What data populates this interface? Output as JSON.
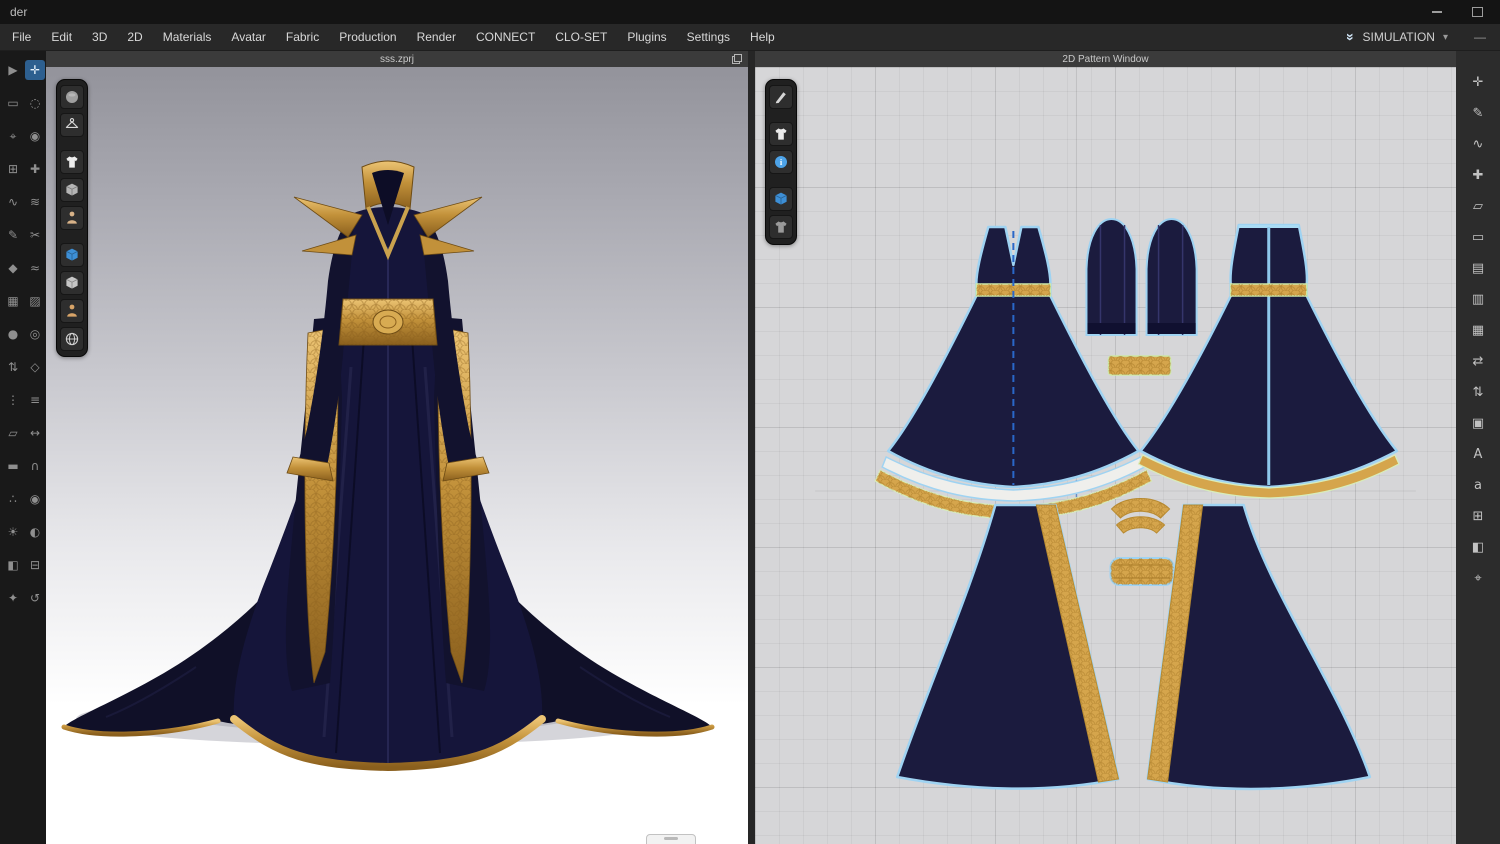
{
  "titlebar": {
    "title": "der"
  },
  "menubar": {
    "items": [
      {
        "label": "File",
        "name": "menu-file"
      },
      {
        "label": "Edit",
        "name": "menu-edit"
      },
      {
        "label": "3D",
        "name": "menu-3d"
      },
      {
        "label": "2D",
        "name": "menu-2d"
      },
      {
        "label": "Materials",
        "name": "menu-materials"
      },
      {
        "label": "Avatar",
        "name": "menu-avatar"
      },
      {
        "label": "Fabric",
        "name": "menu-fabric"
      },
      {
        "label": "Production",
        "name": "menu-production"
      },
      {
        "label": "Render",
        "name": "menu-render"
      },
      {
        "label": "CONNECT",
        "name": "menu-connect"
      },
      {
        "label": "CLO-SET",
        "name": "menu-clo-set"
      },
      {
        "label": "Plugins",
        "name": "menu-plugins"
      },
      {
        "label": "Settings",
        "name": "menu-settings"
      },
      {
        "label": "Help",
        "name": "menu-help"
      }
    ],
    "simulation": {
      "label": "SIMULATION"
    }
  },
  "panel_3d": {
    "title": "sss.zprj"
  },
  "panel_2d": {
    "title": "2D Pattern Window"
  },
  "static_icons": [
    "minimize-icon",
    "maximize-icon",
    "undock-icon",
    "simulation-chevron-icon",
    "simulation-caret-icon",
    "menubar-minimize-icon"
  ],
  "toolbars": {
    "left_3d": [
      {
        "name": "simulate-icon",
        "glyph": "▶"
      },
      {
        "name": "select-move-icon",
        "glyph": "✛",
        "sel": "1"
      },
      {
        "name": "select-box-icon",
        "glyph": "▭"
      },
      {
        "name": "select-lasso-icon",
        "glyph": "◌"
      },
      {
        "name": "transform-gizmo-icon",
        "glyph": "⌖"
      },
      {
        "name": "pin-icon",
        "glyph": "◉"
      },
      {
        "name": "pin-box-icon",
        "glyph": "⊞"
      },
      {
        "name": "tack-icon",
        "glyph": "✚"
      },
      {
        "name": "segment-sewing-icon",
        "glyph": "∿"
      },
      {
        "name": "free-sewing-icon",
        "glyph": "≋"
      },
      {
        "name": "edit-sewing-icon",
        "glyph": "✎"
      },
      {
        "name": "remove-sewing-icon",
        "glyph": "✂"
      },
      {
        "name": "fold-arrangement-icon",
        "glyph": "◆"
      },
      {
        "name": "wind-icon",
        "glyph": "≈"
      },
      {
        "name": "fabric-swatch-icon",
        "glyph": "▦"
      },
      {
        "name": "texture-icon",
        "glyph": "▨"
      },
      {
        "name": "button-icon",
        "glyph": "●"
      },
      {
        "name": "buttonhole-icon",
        "glyph": "◎"
      },
      {
        "name": "zipper-icon",
        "glyph": "⇅"
      },
      {
        "name": "trim-icon",
        "glyph": "◇"
      },
      {
        "name": "topstitch-icon",
        "glyph": "⋮"
      },
      {
        "name": "shirring-icon",
        "glyph": "≡"
      },
      {
        "name": "flatten-icon",
        "glyph": "▱"
      },
      {
        "name": "measure-icon",
        "glyph": "↔"
      },
      {
        "name": "tape-icon",
        "glyph": "▬"
      },
      {
        "name": "avatar-tape-icon",
        "glyph": "∩"
      },
      {
        "name": "arrangement-point-icon",
        "glyph": "∴"
      },
      {
        "name": "camera-icon",
        "glyph": "◉"
      },
      {
        "name": "light-icon",
        "glyph": "☀"
      },
      {
        "name": "render-preview-icon",
        "glyph": "◐"
      },
      {
        "name": "colorway-icon",
        "glyph": "◧"
      },
      {
        "name": "uv-edit-icon",
        "glyph": "⊟"
      },
      {
        "name": "avatar-display-icon",
        "glyph": "✦"
      },
      {
        "name": "history-icon",
        "glyph": "↺"
      }
    ],
    "right_2d": [
      {
        "name": "transform-pattern-icon",
        "glyph": "✛"
      },
      {
        "name": "edit-pattern-icon",
        "glyph": "✎"
      },
      {
        "name": "edit-curvature-icon",
        "glyph": "∿"
      },
      {
        "name": "add-point-icon",
        "glyph": "✚"
      },
      {
        "name": "create-polygon-icon",
        "glyph": "▱"
      },
      {
        "name": "create-rectangle-icon",
        "glyph": "▭"
      },
      {
        "name": "copy-pattern-icon",
        "glyph": "▤"
      },
      {
        "name": "mirror-paste-icon",
        "glyph": "▥"
      },
      {
        "name": "clone-layer-icon",
        "glyph": "▦"
      },
      {
        "name": "unfold-icon",
        "glyph": "⇄"
      },
      {
        "name": "fold-icon",
        "glyph": "⇅"
      },
      {
        "name": "seam-allowance-icon",
        "glyph": "▣"
      },
      {
        "name": "text-tool-icon",
        "glyph": "A"
      },
      {
        "name": "annotation-tool-icon",
        "glyph": "a"
      },
      {
        "name": "grading-icon",
        "glyph": "⊞"
      },
      {
        "name": "texture-edit-icon",
        "glyph": "◧"
      },
      {
        "name": "zoom-fit-icon",
        "glyph": "⌖"
      }
    ],
    "float_3d": [
      {
        "name": "render-style-icon",
        "symbol": "#sym-sphere",
        "style": "color:#9f9f9f"
      },
      {
        "name": "hanger-icon",
        "symbol": "#sym-hanger",
        "style": "color:#d6d6d6"
      },
      {
        "name": "show-garment-icon",
        "symbol": "#sym-shirt",
        "style": "color:#ececec",
        "grp": "1"
      },
      {
        "name": "show-attachments-icon",
        "symbol": "#sym-cube",
        "style": "color:#b5b5b5"
      },
      {
        "name": "show-avatar-icon",
        "symbol": "#sym-person",
        "style": "color:#d8b288"
      },
      {
        "name": "gizmo-toggle-icon",
        "symbol": "#sym-cube",
        "style": "color:#3d8fd6",
        "grp": "1"
      },
      {
        "name": "show-mesh-icon",
        "symbol": "#sym-cube",
        "style": "color:#c6c6c6"
      },
      {
        "name": "mannequin-icon",
        "symbol": "#sym-person",
        "style": "color:#d8a468"
      },
      {
        "name": "environment-icon",
        "symbol": "#sym-globe",
        "style": "color:#d0d0d0"
      }
    ],
    "float_2d": [
      {
        "name": "needle-tool-icon",
        "symbol": "#sym-pen",
        "style": "color:#d6d6d6"
      },
      {
        "name": "show-garment-2d-icon",
        "symbol": "#sym-shirt",
        "style": "color:#ececec",
        "grp": "1"
      },
      {
        "name": "pattern-info-icon",
        "symbol": "#sym-info",
        "style": "color:#4da3e8"
      },
      {
        "name": "show-3d-sync-icon",
        "symbol": "#sym-cube",
        "style": "color:#3d8fd6",
        "grp": "1"
      },
      {
        "name": "show-base-pattern-icon",
        "symbol": "#sym-shirt",
        "style": "color:#9a9a9a"
      }
    ]
  },
  "colors": {
    "navy": "#15153a",
    "navy_dark": "#101028",
    "navy_2d": "#1b1b3e",
    "gold": "#c8973c",
    "gold_light": "#e4bd6a",
    "gold_2d": "#d5a54c",
    "outline_blue": "#9fd3f2",
    "belt_outline": "#cfe9a8",
    "dash_blue": "#2a67c8",
    "accent_blue": "#3d8fd6"
  }
}
